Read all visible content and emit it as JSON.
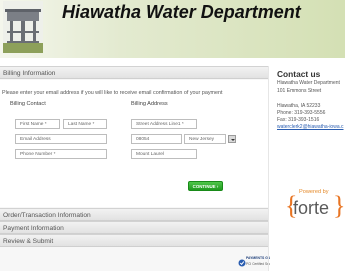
{
  "header": {
    "title": "Hiawatha Water Department"
  },
  "billing": {
    "section_title": "Billing Information",
    "intro": "Please enter your email address if you will like to receive email confirmation of your payment",
    "contact_label": "Billing Contact",
    "address_label": "Billing Address",
    "first_name": "First Name *",
    "last_name": "Last Name *",
    "email": "Email Address",
    "phone": "Phone Number *",
    "street": "Street Address Line1 *",
    "zip": "08054",
    "state": "New Jersey",
    "city": "Mount Laurel",
    "continue_label": "CONTINUE"
  },
  "sections": {
    "order": "Order/Transaction Information",
    "payment": "Payment Information",
    "review": "Review & Submit"
  },
  "contact": {
    "heading": "Contact us",
    "org": "Hiawatha Water Department",
    "street": "101 Emmons Street",
    "city": "Hiawatha, IA 52233",
    "phone": "Phone: 319-393-5556",
    "fax": "Fax: 319-393-1516",
    "email": "waterclerk2@hiawatha-iowa.c"
  },
  "powered": {
    "label": "Powered by",
    "brand": "forte"
  },
  "badge": {
    "line1": "PAYMENTS GATEWAY",
    "line2": "PCI Certified Secure"
  },
  "colors": {
    "accent": "#e87422",
    "continue": "#2aa52a",
    "link": "#2a5db0"
  }
}
